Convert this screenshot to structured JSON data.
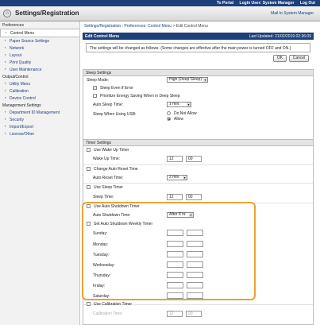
{
  "topbar": {
    "portal": "To Portal",
    "login": "Login User: System Manager",
    "logout": "Log Out"
  },
  "header": {
    "title": "Settings/Registration",
    "mail": "Mail to System Manager"
  },
  "sidebar": {
    "preferences": "Preferences",
    "pref_items": [
      "Control Menu",
      "Paper Source Settings",
      "Network",
      "Layout",
      "Print Quality",
      "User Maintenance"
    ],
    "output": "Output/Control",
    "out_items": [
      "Utility Menu",
      "Calibration",
      "Device Control"
    ],
    "mgmt": "Management Settings",
    "mgmt_items": [
      "Department ID Management",
      "Security",
      "Import/Export",
      "License/Other"
    ]
  },
  "crumb": {
    "a": "Settings/Registration",
    "b": "Preferences: Control Menu",
    "c": "Edit Control Menu",
    "sep": " : ",
    "arrow": " > "
  },
  "title": {
    "text": "Edit Control Menu",
    "updated": "Last Updated: 21/02/2019 02:36:09"
  },
  "notice": "The settings will be changed as follows. (Some changes are effective after the main power is turned OFF and ON.)",
  "buttons": {
    "ok": "OK",
    "cancel": "Cancel"
  },
  "sleep": {
    "header": "Sleep Settings",
    "mode_label": "Sleep Mode:",
    "mode_value": "High (Deep Sleep)",
    "even_error": "Sleep Even if Error",
    "prioritize": "Prioritize Energy Saving When in Deep Sleep",
    "time_label": "Auto Sleep Time:",
    "time_value": "1 min.",
    "usb_label": "Sleep When Using USB:",
    "usb_opt1": "Do Not Allow",
    "usb_opt2": "Allow"
  },
  "timer": {
    "header": "Timer Settings",
    "wake_title": "Use Wake Up Timer",
    "wake_label": "Wake Up Time:",
    "wake_h": "12",
    "wake_m": "00",
    "reset_title": "Change Auto Reset Time",
    "reset_label": "Auto Reset Time:",
    "reset_value": "2 min.",
    "sleep_title": "Use Sleep Timer",
    "sleep_label": "Sleep Time:",
    "sleep_h": "12",
    "sleep_m": "00",
    "shutdown_title": "Use Auto Shutdown Timer",
    "shutdown_label": "Auto Shutdown Time:",
    "shutdown_value": "After 8 hr.",
    "weekly_title": "Set Auto Shutdown Weekly Timer",
    "days": [
      "Sunday:",
      "Monday:",
      "Tuesday:",
      "Wednesday:",
      "Thursday:",
      "Friday:",
      "Saturday:"
    ],
    "calib_title": "Use Calibration Timer",
    "calib_label": "Calibration Time:",
    "calib_h": "12",
    "calib_m": "00"
  },
  "colors": {
    "brand": "#1d3f7a",
    "highlight": "#e8a233"
  }
}
